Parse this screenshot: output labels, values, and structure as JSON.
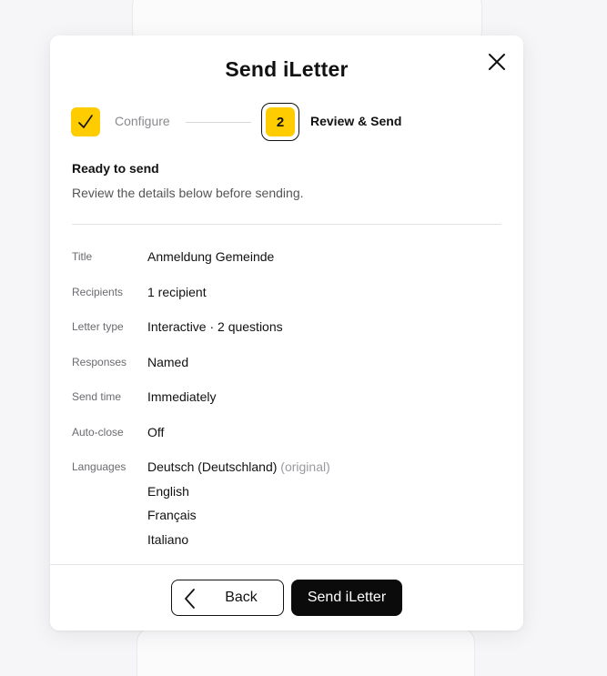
{
  "modal": {
    "title": "Send iLetter",
    "close_icon": "close-icon"
  },
  "stepper": {
    "step1": {
      "label": "Configure",
      "icon": "checkmark-icon",
      "status": "completed"
    },
    "step2": {
      "number": "2",
      "label": "Review & Send",
      "status": "active"
    }
  },
  "summary": {
    "heading": "Ready to send",
    "subtext": "Review the details below before sending."
  },
  "details": {
    "title": {
      "label": "Title",
      "value": "Anmeldung Gemeinde"
    },
    "recipients": {
      "label": "Recipients",
      "value": "1 recipient"
    },
    "letter_type": {
      "label": "Letter type",
      "value": "Interactive · 2 questions"
    },
    "responses": {
      "label": "Responses",
      "value": "Named"
    },
    "send_time": {
      "label": "Send time",
      "value": "Immediately"
    },
    "auto_close": {
      "label": "Auto-close",
      "value": "Off"
    },
    "languages": {
      "label": "Languages",
      "items": [
        {
          "name": "Deutsch (Deutschland)",
          "note": "(original)"
        },
        {
          "name": "English"
        },
        {
          "name": "Français"
        },
        {
          "name": "Italiano"
        }
      ]
    }
  },
  "footer": {
    "back_label": "Back",
    "send_label": "Send iLetter",
    "back_icon": "chevron-left-icon"
  },
  "colors": {
    "accent": "#ffcc00",
    "primary_button": "#0b0b0b"
  }
}
